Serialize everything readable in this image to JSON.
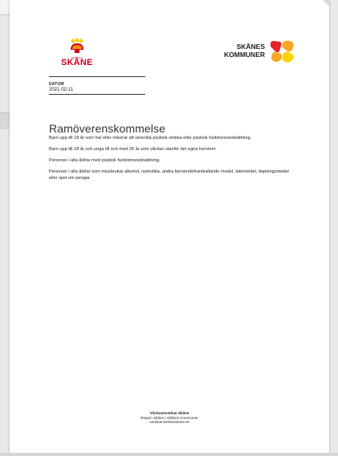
{
  "logos": {
    "region_skane": {
      "small_text": "REGION",
      "name": "SKÅNE",
      "icon": "region-skane-flower-icon",
      "colors": {
        "red": "#d2001f",
        "orange": "#f39200",
        "yellow": "#ffd000"
      }
    },
    "skanes_kommuner": {
      "line1": "SKÅNES",
      "line2": "KOMMUNER",
      "icon": "skanes-kommuner-mark-icon",
      "colors": {
        "red": "#e4202a",
        "orange": "#f7a823",
        "yellow": "#fdd200"
      }
    }
  },
  "date": {
    "label": "DATUM",
    "value": "2021-02-11"
  },
  "document": {
    "title": "Ramöverenskommelse",
    "paragraphs": [
      "Barn upp till 18 år som har eller riskerar att utveckla psykisk ohälsa eller psykisk funktionsnedsättning.",
      "Barn upp till 18 år och unga till och med 20 år som vårdas utanför det egna hemmet.",
      "Personer i alla åldrar med psykisk funktionsnedsättning.",
      "Personer i alla åldrar som missbrukar alkohol, narkotika, andra beroendeframkallande medel, läkemedel, dopningsmedel eller spel om pengar."
    ]
  },
  "footer": {
    "line1": "Vårdsamverkan Skåne",
    "line2": "Region Skåne | Skånes Kommuner",
    "line3": "vardsamverkanskane.se"
  }
}
